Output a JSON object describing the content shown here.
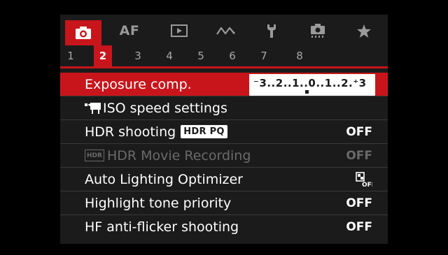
{
  "tabs": [
    {
      "name": "shooting",
      "icon": "camera-icon",
      "active": true
    },
    {
      "name": "af",
      "label": "AF",
      "active": false
    },
    {
      "name": "playback",
      "icon": "play-icon",
      "active": false
    },
    {
      "name": "wireless",
      "icon": "wireless-icon",
      "active": false
    },
    {
      "name": "setup",
      "icon": "wrench-icon",
      "active": false
    },
    {
      "name": "custom-functions",
      "icon": "custom-camera-icon",
      "active": false
    },
    {
      "name": "my-menu",
      "icon": "star-icon",
      "active": false
    }
  ],
  "pages": [
    "1",
    "2",
    "3",
    "4",
    "5",
    "6",
    "7",
    "8"
  ],
  "active_page": "2",
  "menu": {
    "exposure_comp": {
      "label": "Exposure comp.",
      "scale": "⁻3..2..1..0..1..2.⁺3"
    },
    "iso_speed": {
      "label": "ISO speed settings"
    },
    "hdr_shooting": {
      "label": "HDR shooting",
      "badge": "HDR PQ",
      "value": "OFF"
    },
    "hdr_movie": {
      "label": "HDR Movie Recording",
      "icon_text": "HDR",
      "value": "OFF"
    },
    "alo": {
      "label": "Auto Lighting Optimizer",
      "icon": "alo-off-icon",
      "icon_text": "OFF"
    },
    "highlight_tone": {
      "label": "Highlight tone priority",
      "value": "OFF"
    },
    "hf_anti_flicker": {
      "label": "HF anti-flicker shooting",
      "value": "OFF"
    }
  },
  "colors": {
    "accent": "#c8151b",
    "background": "#1b1b1b",
    "disabled": "#6a6a6a"
  }
}
